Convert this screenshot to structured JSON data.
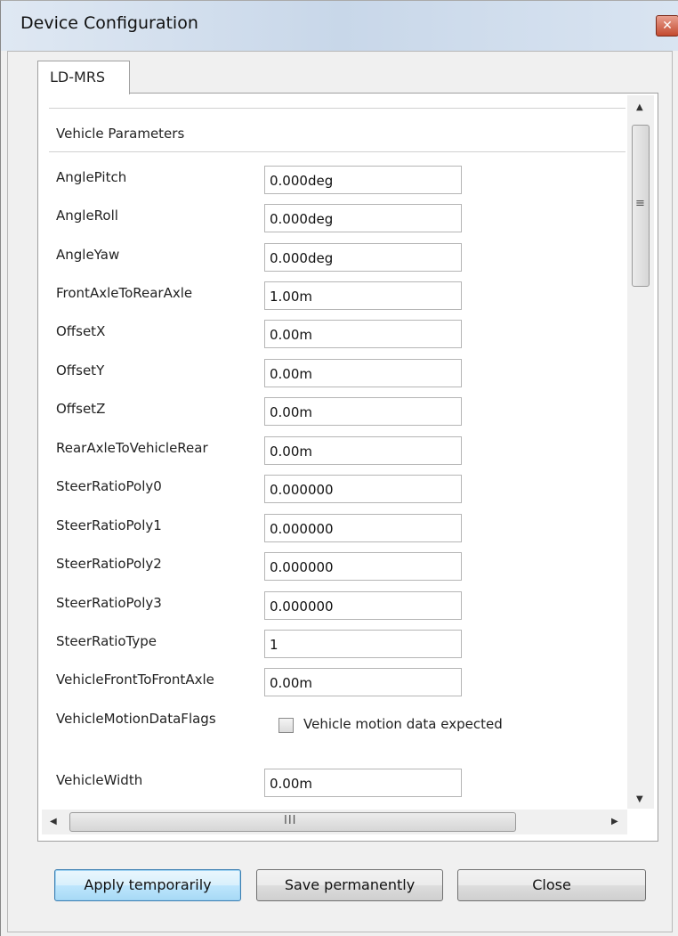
{
  "window": {
    "title": "Device Configuration",
    "close_glyph": "✕"
  },
  "tabs": [
    {
      "label": "LD-MRS",
      "active": true
    }
  ],
  "section": {
    "title": "Vehicle Parameters"
  },
  "params": [
    {
      "label": "AnglePitch",
      "value": "0.000deg"
    },
    {
      "label": "AngleRoll",
      "value": "0.000deg"
    },
    {
      "label": "AngleYaw",
      "value": "0.000deg"
    },
    {
      "label": "FrontAxleToRearAxle",
      "value": "1.00m"
    },
    {
      "label": "OffsetX",
      "value": "0.00m"
    },
    {
      "label": "OffsetY",
      "value": "0.00m"
    },
    {
      "label": "OffsetZ",
      "value": "0.00m"
    },
    {
      "label": "RearAxleToVehicleRear",
      "value": "0.00m"
    },
    {
      "label": "SteerRatioPoly0",
      "value": "0.000000"
    },
    {
      "label": "SteerRatioPoly1",
      "value": "0.000000"
    },
    {
      "label": "SteerRatioPoly2",
      "value": "0.000000"
    },
    {
      "label": "SteerRatioPoly3",
      "value": "0.000000"
    },
    {
      "label": "SteerRatioType",
      "value": "1"
    },
    {
      "label": "VehicleFrontToFrontAxle",
      "value": "0.00m"
    }
  ],
  "motion_flags": {
    "label": "VehicleMotionDataFlags",
    "checkbox_label": "Vehicle motion data expected",
    "checked": false
  },
  "vehicle_width": {
    "label": "VehicleWidth",
    "value": "0.00m"
  },
  "scrollbars": {
    "up_arrow": "▲",
    "down_arrow": "▼",
    "left_arrow": "◀",
    "right_arrow": "▶",
    "v_grip": "≡",
    "h_grip": "III"
  },
  "buttons": {
    "apply": "Apply temporarily",
    "save": "Save permanently",
    "close": "Close"
  }
}
